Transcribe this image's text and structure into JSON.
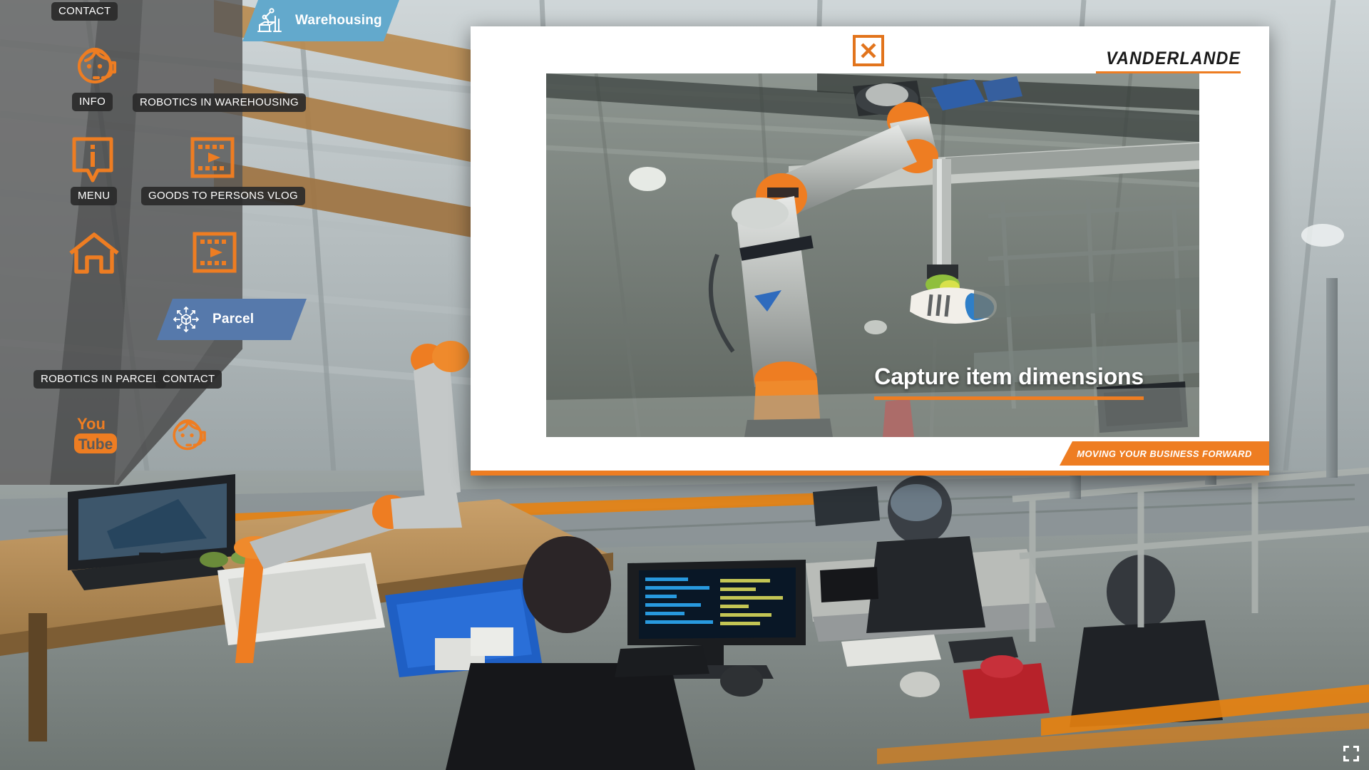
{
  "background": {
    "description": "warehouse robotics workstation photo"
  },
  "sidebar": {
    "top_contact_label": "CONTACT",
    "items": [
      {
        "id": "info",
        "icon": "headset-avatar-icon",
        "label": "INFO"
      },
      {
        "id": "menu",
        "icon": "info-bubble-icon",
        "label": "MENU"
      },
      {
        "id": "home",
        "icon": "home-icon",
        "label": ""
      },
      {
        "id": "youtube",
        "icon": "youtube-icon",
        "label": ""
      },
      {
        "id": "contact-avatar",
        "icon": "headset-avatar-icon",
        "label": ""
      }
    ],
    "video_items": [
      {
        "id": "robotics-in-warehousing",
        "icon": "film-play-icon",
        "label": "ROBOTICS IN WAREHOUSING"
      },
      {
        "id": "goods-to-persons-vlog",
        "icon": "film-play-icon",
        "label": "GOODS TO PERSONS VLOG"
      },
      {
        "id": "robotics-in-parcel",
        "icon": "film-play-icon",
        "label": "ROBOTICS IN PARCEL"
      }
    ],
    "bottom_contact_label": "CONTACT"
  },
  "sector_tabs": [
    {
      "id": "warehousing",
      "label": "Warehousing",
      "icon": "robot-arm-icon",
      "color": "#63a9cc",
      "active": true
    },
    {
      "id": "parcel",
      "label": "Parcel",
      "icon": "parcel-routing-icon",
      "color": "#5679ab",
      "active": false
    }
  ],
  "modal": {
    "close_label": "×",
    "brand": "VANDERLANDE",
    "video": {
      "caption": "Capture item dimensions",
      "accent_color": "#ee7d22"
    },
    "slogan": "MOVING YOUR BUSINESS FORWARD"
  },
  "controls": {
    "fullscreen": "fullscreen-icon"
  },
  "colors": {
    "orange": "#ee7d22",
    "tab_warehousing": "#63a9cc",
    "tab_parcel": "#5679ab",
    "panel": "rgba(70,70,70,0.80)",
    "chip": "rgba(42,42,42,0.92)"
  }
}
